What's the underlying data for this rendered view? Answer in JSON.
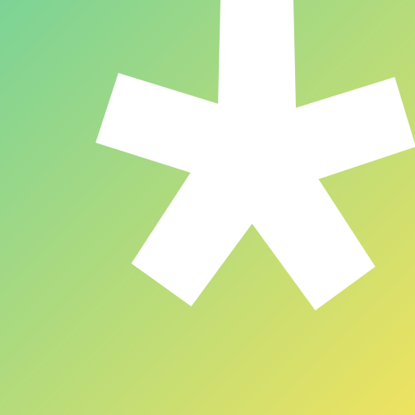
{
  "logo": {
    "icon_name": "asterisk-icon",
    "colors": {
      "gradient_start": "#7CD396",
      "gradient_end": "#EEE360",
      "mark": "#FFFFFF"
    }
  }
}
